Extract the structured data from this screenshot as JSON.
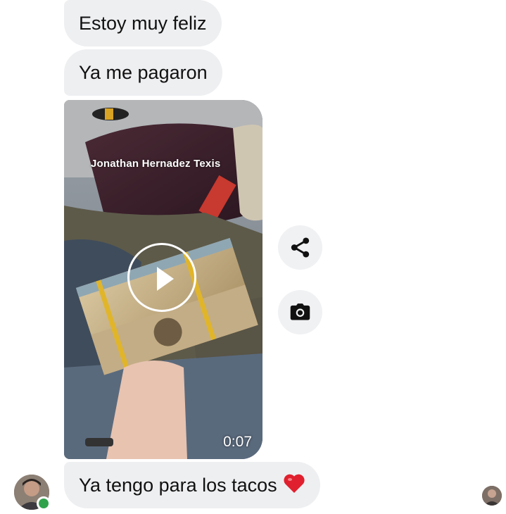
{
  "messages": [
    {
      "text": "Estoy muy feliz"
    },
    {
      "text": "Ya me pagaron"
    },
    {
      "text": "Ya tengo para los tacos"
    }
  ],
  "video": {
    "watermark": "Jonathan Hernadez Texis",
    "duration": "0:07"
  },
  "actions": {
    "share_icon": "share-icon",
    "camera_icon": "camera-icon"
  },
  "sender": {
    "online": true
  },
  "colors": {
    "bubble_bg": "#eeeff1",
    "online_green": "#31a24c",
    "heart_red": "#e0202e"
  }
}
